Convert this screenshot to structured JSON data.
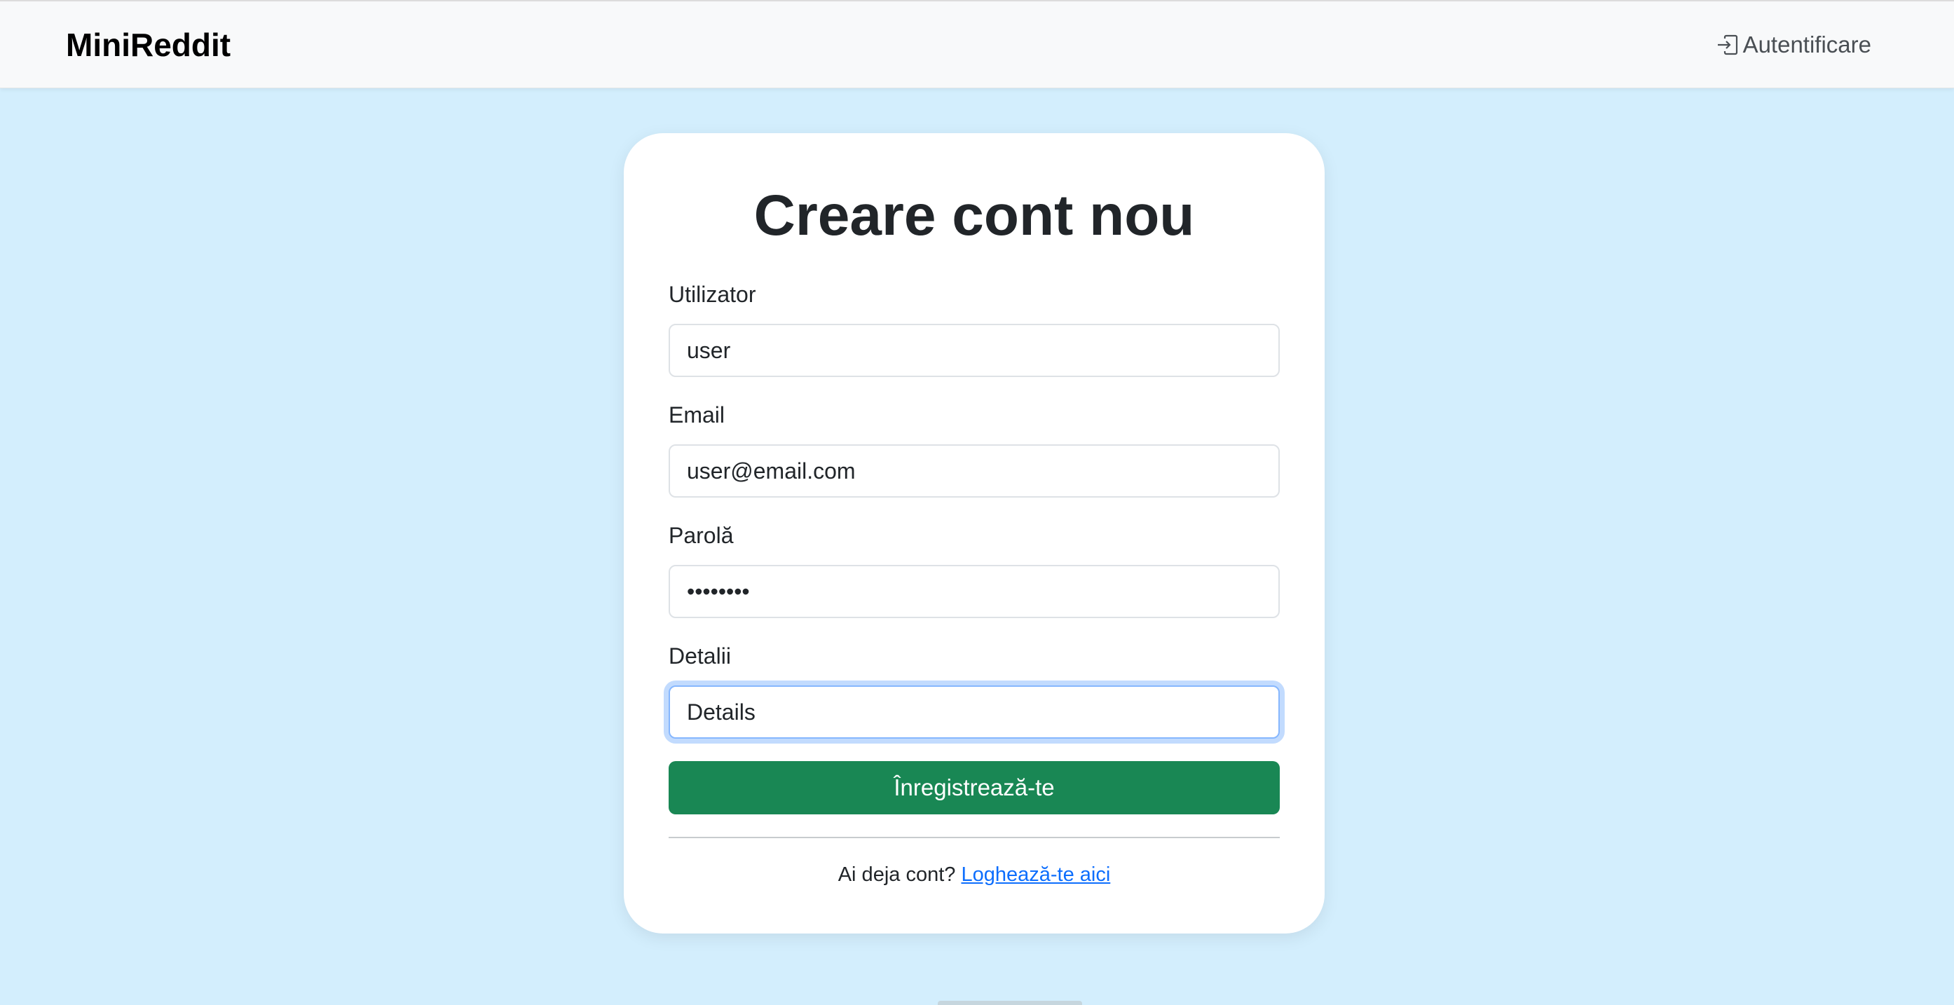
{
  "navbar": {
    "brand": "MiniReddit",
    "login_icon": "box-arrow-in-right-icon",
    "login_label": "Autentificare"
  },
  "form": {
    "title": "Creare cont nou",
    "fields": [
      {
        "label": "Utilizator",
        "value": "user",
        "type": "text"
      },
      {
        "label": "Email",
        "value": "user@email.com",
        "type": "email"
      },
      {
        "label": "Parolă",
        "value": "••••••••",
        "type": "password"
      },
      {
        "label": "Detalii",
        "value": "Details",
        "type": "text",
        "focused": true
      }
    ],
    "submit_label": "Înregistrează-te",
    "footer_prompt": "Ai deja cont?",
    "footer_link": "Loghează-te aici"
  },
  "colors": {
    "page_background": "#d3eefd",
    "submit_button": "#198754",
    "link": "#0d6efd"
  }
}
